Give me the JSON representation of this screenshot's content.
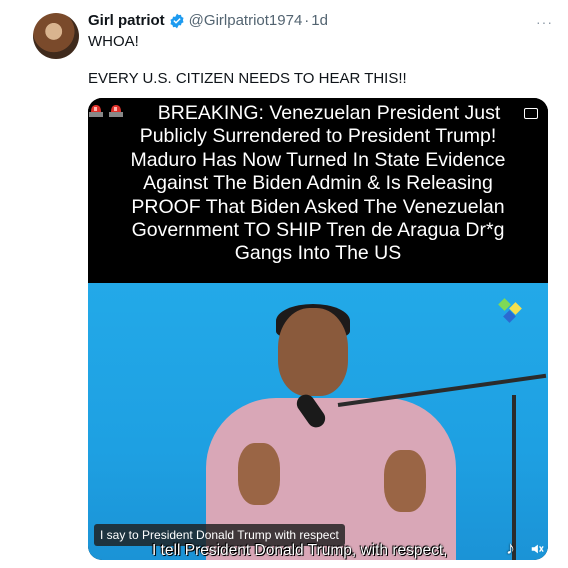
{
  "tweet": {
    "author_name": "Girl patriot",
    "handle": "@Girlpatriot1974",
    "separator": "·",
    "time": "1d",
    "more_label": "···",
    "text_line1": "WHOA!",
    "text_line2": "EVERY U.S. CITIZEN NEEDS TO HEAR THIS!!"
  },
  "media": {
    "caption_lines": [
      "BREAKING: Venezuelan President Just",
      "Publicly Surrendered to President Trump!",
      "Maduro Has Now Turned In State Evidence",
      "Against The Biden Admin & Is Releasing",
      "PROOF That Biden Asked The Venezuelan",
      "Government TO SHIP Tren de Aragua Dr*g",
      "Gangs Into The US"
    ],
    "subtitle_box": "I say to President Donald Trump with respect",
    "subtitle_burned": "I tell President Donald Trump, with respect,"
  },
  "colors": {
    "verified": "#1d9bf0",
    "video_bg": "#23a9e8",
    "handle": "#536471"
  },
  "icons": [
    "verified-badge-icon",
    "siren-icon",
    "more-icon",
    "tiktok-icon",
    "volume-icon"
  ]
}
